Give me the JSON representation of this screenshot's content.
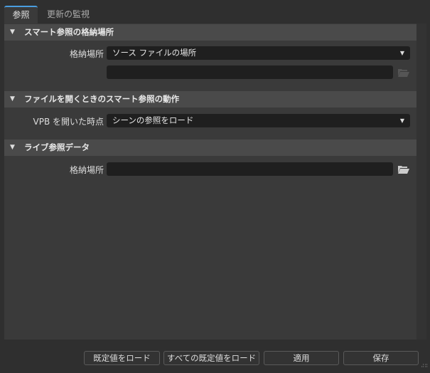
{
  "tabs": [
    {
      "label": "参照",
      "active": true
    },
    {
      "label": "更新の監視",
      "active": false
    }
  ],
  "sections": [
    {
      "title": "スマート参照の格納場所",
      "label": "格納場所",
      "combo_value": "ソース ファイルの場所",
      "path_value": ""
    },
    {
      "title": "ファイルを開くときのスマート参照の動作",
      "label": "VPB を開いた時点",
      "combo_value": "シーンの参照をロード"
    },
    {
      "title": "ライブ参照データ",
      "label": "格納場所",
      "path_value": ""
    }
  ],
  "buttons": {
    "load_default": "既定値をロード",
    "load_all_defaults": "すべての既定値をロード",
    "apply": "適用",
    "save": "保存"
  },
  "colors": {
    "accent": "#4a9ee0",
    "panel": "#3a3a3a",
    "header": "#4a4a4a",
    "field": "#1f1f1f"
  }
}
